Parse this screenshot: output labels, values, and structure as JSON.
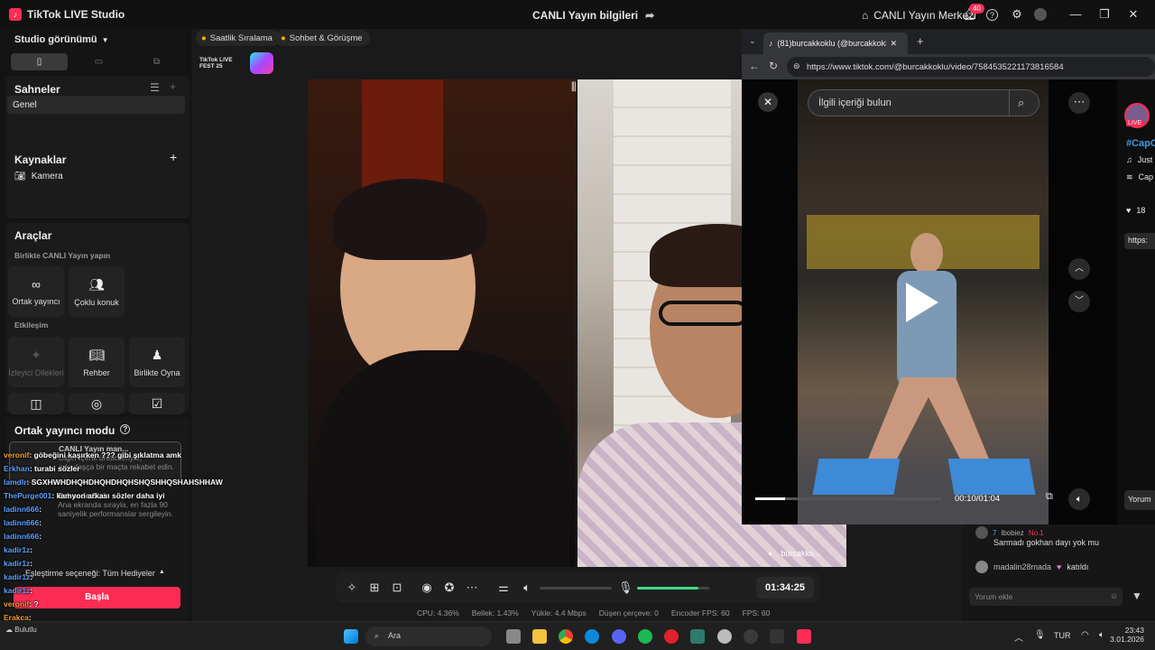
{
  "titlebar": {
    "app_name": "TikTok LIVE Studio",
    "center_title": "CANLI Yayın bilgileri",
    "live_center": "CANLI Yayın Merkezi",
    "notification_count": "40"
  },
  "left": {
    "studio_view": "Studio görünümü",
    "scenes_title": "Sahneler",
    "scene_item": "Genel",
    "sources_title": "Kaynaklar",
    "source_item": "Kamera",
    "tools_title": "Araçlar",
    "collab_subtitle": "Birlikte CANLI Yayın yapın",
    "tile_cohost": "Ortak yayıncı",
    "tile_multi": "Çoklu konuk",
    "interaction_subtitle": "Etkileşim",
    "tile_wishes": "İzleyici Dilekleri",
    "tile_guide": "Rehber",
    "tile_playtogether": "Birlikte Oyna",
    "cohost_mode": "Ortak yayıncı modu",
    "cohost_popup_title": "CANLI Yayın man...",
    "cohost_popup_line1": "Diğer içerik üreticileriyle,",
    "cohost_popup_line2": "arkadaşça bir maçta rekabet edin.",
    "stage_title": "Sahnede Sizin",
    "stage_line1": "Ana ekranda sırayla, en fazla 90",
    "stage_line2": "saniyelik performanslar sergileyin.",
    "match_option": "Eşleştirme seçeneği: Tüm Hediyeler",
    "start_button": "Başla"
  },
  "tags": {
    "hourly_ranking": "Saatlik Sıralama",
    "chat_meet": "Sohbet & Görüşme",
    "fest_label": "TikTok LIVE FEST 25"
  },
  "video": {
    "guest_label": "burcakko..."
  },
  "controls": {
    "timer": "01:34:25",
    "volume_level": 0.0,
    "mic_level": 0.85
  },
  "stats": {
    "cpu": "CPU: 4.36%",
    "memory": "Bellek: 1.43%",
    "upload": "Yükle: 4.4 Mbps",
    "dropped": "Düşen çerçeve: 0",
    "encoder_fps": "Encoder FPS: 60",
    "fps": "FPS: 60"
  },
  "browser": {
    "tab_title": "(81)burcakkoklu (@burcakkoklu) |",
    "url": "https://www.tiktok.com/@burcakkoklu/video/7584535221173816584",
    "search_placeholder": "İlgili içeriği bulun",
    "video_time": "00:10/01:04",
    "video_progress": 0.16,
    "side_hashtag": "#CapC",
    "side_line1": "Just",
    "side_line2": "Cap",
    "side_likes": "18",
    "side_link": "https:",
    "live_badge": "LIVE",
    "comment_button": "Yorum"
  },
  "comments": {
    "c1_user": "lbobiez",
    "c1_level": "7",
    "c1_badge": "No.1",
    "c1_text": "Sarmadı gokhan dayı yok mu",
    "c2_user": "madalin28mada",
    "c2_text": "katıldı",
    "add_comment": "Yorum ekle"
  },
  "chat": [
    {
      "user": "veronif",
      "text": ": göbeğini kaşırken ??? gibi şıklatma amk"
    },
    {
      "user": "Erkhan",
      "text": ": turabi sözler"
    },
    {
      "user": "lamdlr",
      "text": ": SGXHWHDHQHDHQHDHQHSHQSHHQSHAHSHHAW"
    },
    {
      "user": "ThePurge001",
      "text": ": kamyon arkası sözler daha iyi"
    },
    {
      "user": "ladinn666",
      "text": ":"
    },
    {
      "user": "ladinn666",
      "text": ":"
    },
    {
      "user": "ladinn666",
      "text": ":"
    },
    {
      "user": "kadir1z",
      "text": ":"
    },
    {
      "user": "kadir1z",
      "text": ":"
    },
    {
      "user": "kadir1z",
      "text": ":"
    },
    {
      "user": "kadir1z",
      "text": ":"
    },
    {
      "user": "veronif",
      "text": ": ?"
    },
    {
      "user": "Erakca",
      "text": ":"
    },
    {
      "user": "Erakca",
      "text": ":"
    },
    {
      "user": "Erakca",
      "text": ":"
    }
  ],
  "taskbar": {
    "search": "Ara",
    "lang": "TUR",
    "time": "23:43",
    "date": "3.01.2026",
    "weather": "Bulutlu"
  }
}
